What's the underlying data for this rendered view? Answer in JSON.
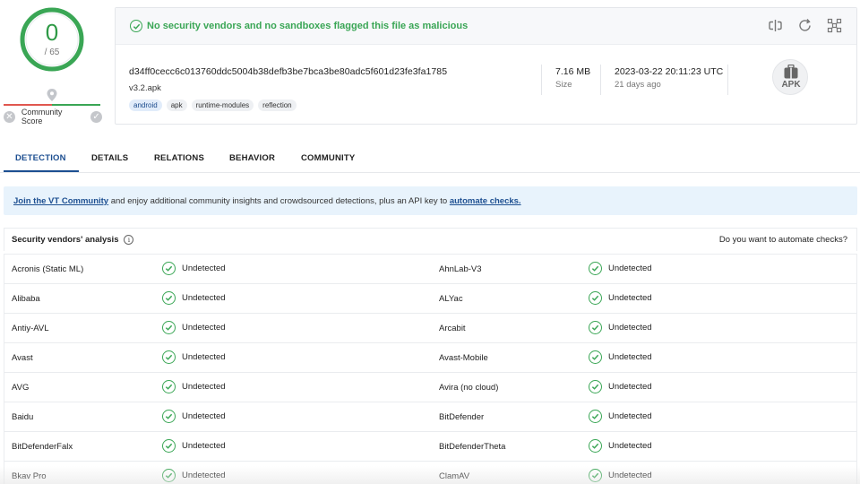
{
  "score": {
    "detections": "0",
    "total": "/ 65"
  },
  "community": {
    "label": "Community Score",
    "x_icon": "✕",
    "check_icon": "✓"
  },
  "banner": {
    "text": "No security vendors and no sandboxes flagged this file as malicious"
  },
  "file": {
    "hash": "d34ff0cecc6c013760ddc5004b38defb3be7bca3be80adc5f601d23fe3fa1785",
    "name": "v3.2.apk",
    "tags": [
      "android",
      "apk",
      "runtime-modules",
      "reflection"
    ],
    "size": "7.16 MB",
    "size_label": "Size",
    "date": "2023-03-22 20:11:23 UTC",
    "date_ago": "21 days ago",
    "type_badge": "APK"
  },
  "tabs": [
    "DETECTION",
    "DETAILS",
    "RELATIONS",
    "BEHAVIOR",
    "COMMUNITY"
  ],
  "notice": {
    "link1": "Join the VT Community",
    "middle": " and enjoy additional community insights and crowdsourced detections, plus an API key to ",
    "link2": "automate checks."
  },
  "analysis": {
    "title": "Security vendors' analysis",
    "info": "i",
    "automate_prompt": "Do you want to automate checks?",
    "rows": [
      {
        "left_vendor": "Acronis (Static ML)",
        "left_status": "Undetected",
        "right_vendor": "AhnLab-V3",
        "right_status": "Undetected"
      },
      {
        "left_vendor": "Alibaba",
        "left_status": "Undetected",
        "right_vendor": "ALYac",
        "right_status": "Undetected"
      },
      {
        "left_vendor": "Antiy-AVL",
        "left_status": "Undetected",
        "right_vendor": "Arcabit",
        "right_status": "Undetected"
      },
      {
        "left_vendor": "Avast",
        "left_status": "Undetected",
        "right_vendor": "Avast-Mobile",
        "right_status": "Undetected"
      },
      {
        "left_vendor": "AVG",
        "left_status": "Undetected",
        "right_vendor": "Avira (no cloud)",
        "right_status": "Undetected"
      },
      {
        "left_vendor": "Baidu",
        "left_status": "Undetected",
        "right_vendor": "BitDefender",
        "right_status": "Undetected"
      },
      {
        "left_vendor": "BitDefenderFalx",
        "left_status": "Undetected",
        "right_vendor": "BitDefenderTheta",
        "right_status": "Undetected"
      },
      {
        "left_vendor": "Bkav Pro",
        "left_status": "Undetected",
        "right_vendor": "ClamAV",
        "right_status": "Undetected"
      }
    ]
  },
  "colors": {
    "clean_green": "#3aa655",
    "link_blue": "#1d4f91",
    "notice_bg": "#e8f3fc"
  }
}
